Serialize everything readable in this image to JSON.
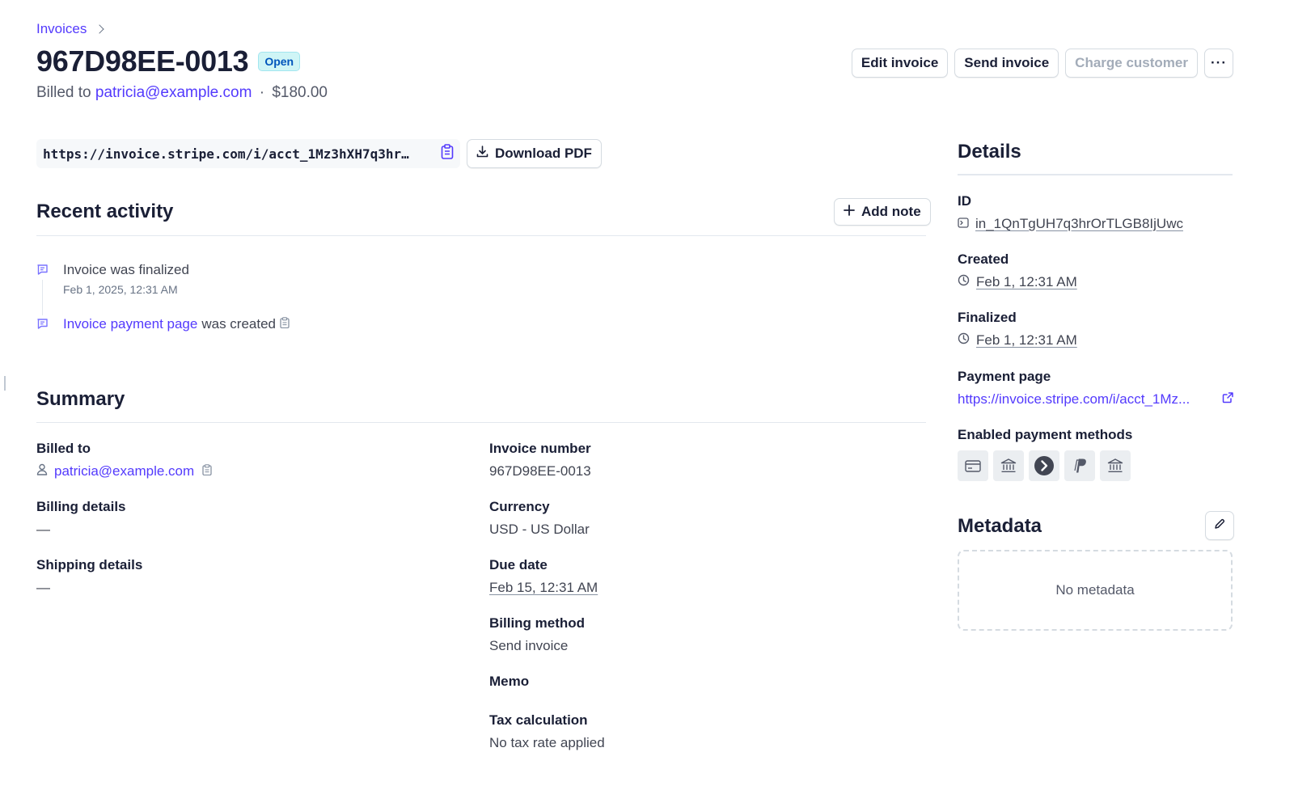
{
  "breadcrumb": {
    "label": "Invoices"
  },
  "header": {
    "invoice_number": "967D98EE-0013",
    "status": "Open",
    "billed_prefix": "Billed to",
    "billed_email": "patricia@example.com",
    "separator": "·",
    "amount": "$180.00"
  },
  "actions": {
    "edit": "Edit invoice",
    "send": "Send invoice",
    "charge": "Charge customer",
    "more": "···"
  },
  "url_row": {
    "url": "https://invoice.stripe.com/i/acct_1Mz3hXH7q3hr…",
    "download": "Download PDF"
  },
  "activity": {
    "title": "Recent activity",
    "add_note": "Add note",
    "items": [
      {
        "text": "Invoice was finalized",
        "time": "Feb 1, 2025, 12:31 AM"
      },
      {
        "link": "Invoice payment page",
        "text": "was created"
      }
    ]
  },
  "summary": {
    "title": "Summary",
    "left": {
      "billed_to_label": "Billed to",
      "billed_to_value": "patricia@example.com",
      "billing_details_label": "Billing details",
      "billing_details_value": "—",
      "shipping_details_label": "Shipping details",
      "shipping_details_value": "—"
    },
    "right": {
      "invoice_number_label": "Invoice number",
      "invoice_number_value": "967D98EE-0013",
      "currency_label": "Currency",
      "currency_value": "USD - US Dollar",
      "due_date_label": "Due date",
      "due_date_value": "Feb 15, 12:31 AM",
      "billing_method_label": "Billing method",
      "billing_method_value": "Send invoice",
      "memo_label": "Memo",
      "tax_label": "Tax calculation",
      "tax_value": "No tax rate applied"
    }
  },
  "details": {
    "title": "Details",
    "id_label": "ID",
    "id_value": "in_1QnTgUH7q3hrOrTLGB8IjUwc",
    "created_label": "Created",
    "created_value": "Feb 1, 12:31 AM",
    "finalized_label": "Finalized",
    "finalized_value": "Feb 1, 12:31 AM",
    "payment_page_label": "Payment page",
    "payment_page_value": "https://invoice.stripe.com/i/acct_1Mz...",
    "payment_methods_label": "Enabled payment methods",
    "payment_methods": [
      "card-icon",
      "bank-icon",
      "arrow-circle-icon",
      "paypal-icon",
      "bank-icon"
    ]
  },
  "metadata": {
    "title": "Metadata",
    "empty": "No metadata"
  },
  "colors": {
    "accent": "#533afd",
    "badge_bg": "#cff5f6",
    "badge_text": "#0055bc",
    "text": "#1a1f36",
    "muted": "#545969"
  }
}
